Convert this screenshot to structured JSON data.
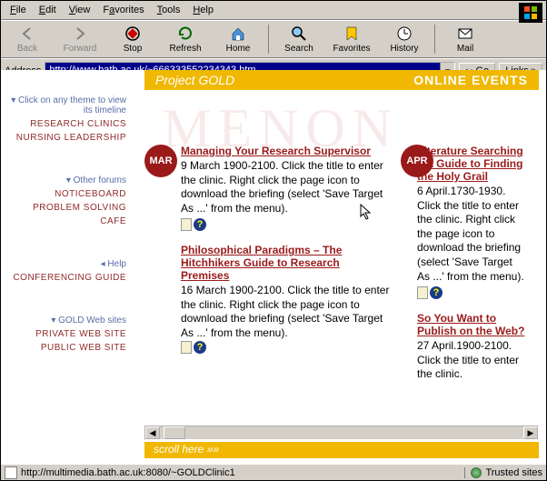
{
  "menu": [
    "File",
    "Edit",
    "View",
    "Favorites",
    "Tools",
    "Help"
  ],
  "toolbar": [
    {
      "label": "Back",
      "disabled": true
    },
    {
      "label": "Forward",
      "disabled": true
    },
    {
      "label": "Stop"
    },
    {
      "label": "Refresh"
    },
    {
      "label": "Home"
    },
    {
      "label": "Search"
    },
    {
      "label": "Favorites"
    },
    {
      "label": "History"
    },
    {
      "label": "Mail"
    }
  ],
  "address_label": "Address",
  "url": "http://www.bath.ac.uk/~666333552234343.htm",
  "go_label": "Go",
  "links_label": "Links",
  "sidebar": {
    "groups": [
      {
        "head": "Click on any theme to view its timeline",
        "arrow": "▾",
        "items": [
          "RESEARCH CLINICS",
          "NURSING LEADERSHIP"
        ]
      },
      {
        "head": "Other forums",
        "arrow": "▾",
        "items": [
          "NOTICEBOARD",
          "PROBLEM SOLVING",
          "CAFE"
        ]
      },
      {
        "head": "Help",
        "arrow": "◂",
        "items": [
          "CONFERENCING GUIDE"
        ]
      },
      {
        "head": "GOLD Web sites",
        "arrow": "▾",
        "items": [
          "PRIVATE WEB SITE",
          "PUBLIC WEB SITE"
        ]
      }
    ]
  },
  "banner": {
    "left": "Project GOLD",
    "right": "ONLINE EVENTS"
  },
  "months": [
    "MAR",
    "APR"
  ],
  "events_mar": [
    {
      "title": "Managing Your Research Supervisor",
      "desc": "9 March 1900-2100. Click the title to enter the clinic. Right click the page icon to download the briefing (select 'Save Target As ...' from the menu)."
    },
    {
      "title": "Philosophical Paradigms – The Hitchhikers Guide to Research Premises",
      "desc": "16 March 1900-2100. Click the title to enter the clinic. Right click the page icon to download the briefing (select 'Save Target As ...' from the menu)."
    }
  ],
  "events_apr": [
    {
      "title": "Literature Searching – A Guide to Finding the Holy Grail",
      "desc": "6 April.1730-1930. Click the title to enter the clinic. Right click the page icon to download the briefing (select 'Save Target As ...' from the menu)."
    },
    {
      "title": "So You Want to Publish on the Web?",
      "desc": "27 April.1900-2100. Click the title to enter the clinic."
    }
  ],
  "scroll_hint": "scroll here  »»",
  "status_url": "http://multimedia.bath.ac.uk:8080/~GOLDClinic1",
  "status_zone": "Trusted sites"
}
